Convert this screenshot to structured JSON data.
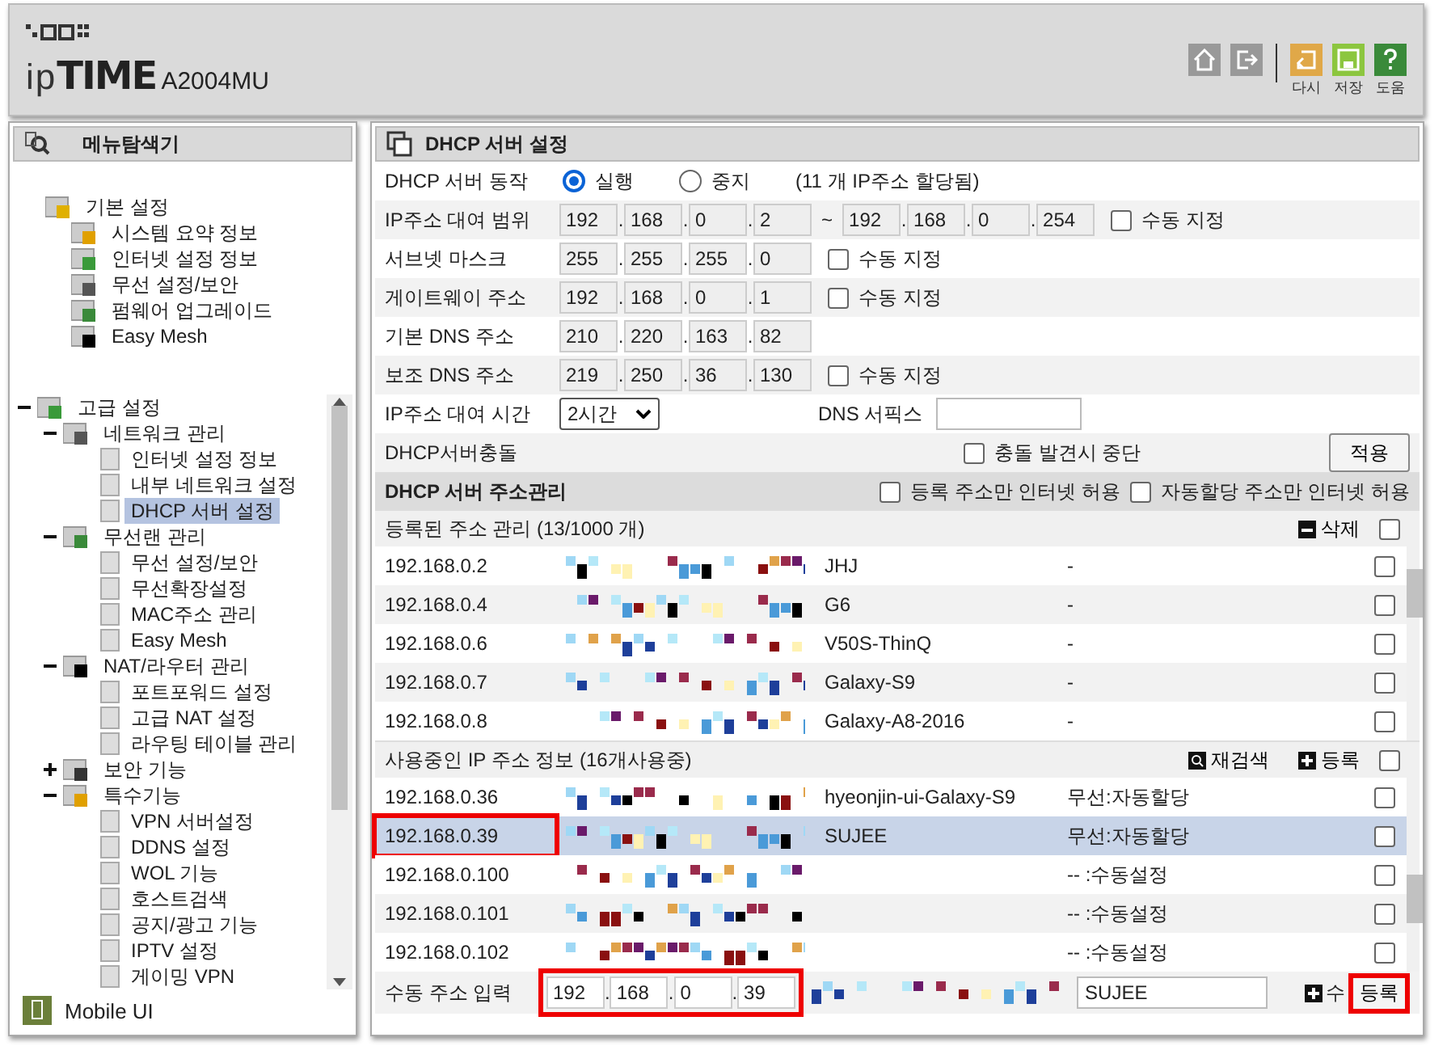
{
  "header": {
    "logo_prefix": "ip",
    "logo_main": "TIME",
    "model": "A2004MU",
    "buttons": [
      {
        "kind": "home"
      },
      {
        "kind": "logout"
      },
      {
        "kind": "refresh",
        "label": "다시"
      },
      {
        "kind": "save",
        "label": "저장"
      },
      {
        "kind": "help",
        "label": "도움"
      }
    ]
  },
  "sidebar": {
    "title": "메뉴탐색기",
    "basic": {
      "label": "기본 설정",
      "items": [
        {
          "label": "시스템 요약 정보",
          "selected": false
        },
        {
          "label": "인터넷 설정 정보",
          "selected": false
        },
        {
          "label": "무선 설정/보안",
          "selected": false
        },
        {
          "label": "펌웨어 업그레이드",
          "selected": false
        },
        {
          "label": "Easy Mesh",
          "selected": false
        }
      ]
    },
    "advanced": {
      "label": "고급 설정",
      "expanded": true,
      "children": [
        {
          "label": "네트워크 관리",
          "expanded": true,
          "children": [
            {
              "label": "인터넷 설정 정보",
              "selected": false
            },
            {
              "label": "내부 네트워크 설정",
              "selected": false
            },
            {
              "label": "DHCP 서버 설정",
              "selected": true
            }
          ]
        },
        {
          "label": "무선랜 관리",
          "expanded": true,
          "children": [
            {
              "label": "무선 설정/보안",
              "selected": false
            },
            {
              "label": "무선확장설정",
              "selected": false
            },
            {
              "label": "MAC주소 관리",
              "selected": false
            },
            {
              "label": "Easy Mesh",
              "selected": false
            }
          ]
        },
        {
          "label": "NAT/라우터 관리",
          "expanded": true,
          "children": [
            {
              "label": "포트포워드 설정",
              "selected": false
            },
            {
              "label": "고급 NAT 설정",
              "selected": false
            },
            {
              "label": "라우팅 테이블 관리",
              "selected": false
            }
          ]
        },
        {
          "label": "보안 기능",
          "expanded": false
        },
        {
          "label": "특수기능",
          "expanded": true,
          "children": [
            {
              "label": "VPN 서버설정",
              "selected": false
            },
            {
              "label": "DDNS 설정",
              "selected": false
            },
            {
              "label": "WOL 기능",
              "selected": false
            },
            {
              "label": "호스트검색",
              "selected": false
            },
            {
              "label": "공지/광고 기능",
              "selected": false
            },
            {
              "label": "IPTV 설정",
              "selected": false
            },
            {
              "label": "게이밍 VPN",
              "selected": false
            }
          ]
        }
      ]
    },
    "mobile": "Mobile UI"
  },
  "main": {
    "title": "DHCP 서버 설정",
    "separator": ".",
    "form": [
      {
        "kind": "radio",
        "label": "DHCP 서버 동작",
        "options": [
          {
            "label": "실행",
            "selected": true
          },
          {
            "label": "중지",
            "selected": false
          }
        ],
        "note": "(11 개 IP주소 할당됨)"
      },
      {
        "kind": "range",
        "label": "IP주소 대여 범위",
        "start": [
          "192",
          "168",
          "0",
          "2"
        ],
        "tilde": "~",
        "end": [
          "192",
          "168",
          "0",
          "254"
        ],
        "checkbox": {
          "label": "수동 지정",
          "checked": false
        }
      },
      {
        "kind": "ip",
        "label": "서브넷 마스크",
        "ip": [
          "255",
          "255",
          "255",
          "0"
        ],
        "checkbox": {
          "label": "수동 지정",
          "checked": false
        }
      },
      {
        "kind": "ip",
        "label": "게이트웨이 주소",
        "ip": [
          "192",
          "168",
          "0",
          "1"
        ],
        "checkbox": {
          "label": "수동 지정",
          "checked": false
        }
      },
      {
        "kind": "ip",
        "label": "기본 DNS 주소",
        "ip": [
          "210",
          "220",
          "163",
          "82"
        ]
      },
      {
        "kind": "ip",
        "label": "보조 DNS 주소",
        "ip": [
          "219",
          "250",
          "36",
          "130"
        ],
        "checkbox": {
          "label": "수동 지정",
          "checked": false
        }
      },
      {
        "kind": "select",
        "label": "IP주소 대여 시간",
        "value": "2시간",
        "suffix_label": "DNS 서픽스"
      },
      {
        "kind": "conflict",
        "label": "DHCP서버충돌",
        "checkbox": {
          "label": "충돌 발견시 중단",
          "checked": false
        },
        "button": "적용"
      }
    ],
    "management": {
      "title": "DHCP 서버 주소관리",
      "options": [
        {
          "label": "등록 주소만 인터넷 허용",
          "checked": false
        },
        {
          "label": "자동할당 주소만 인터넷 허용",
          "checked": false
        }
      ]
    },
    "registered": {
      "title": "등록된 주소 관리 (13/1000 개)",
      "delete": "삭제",
      "all_checked": false,
      "rows": [
        {
          "ip": "192.168.0.2",
          "name": "JHJ",
          "status": "-",
          "checked": false,
          "selected": false,
          "highlighted": false
        },
        {
          "ip": "192.168.0.4",
          "name": "G6",
          "status": "-",
          "checked": false,
          "selected": false,
          "highlighted": false
        },
        {
          "ip": "192.168.0.6",
          "name": "V50S-ThinQ",
          "status": "-",
          "checked": false,
          "selected": false,
          "highlighted": false
        },
        {
          "ip": "192.168.0.7",
          "name": "Galaxy-S9",
          "status": "-",
          "checked": false,
          "selected": false,
          "highlighted": false
        },
        {
          "ip": "192.168.0.8",
          "name": "Galaxy-A8-2016",
          "status": "-",
          "checked": false,
          "selected": false,
          "highlighted": false
        }
      ]
    },
    "in_use": {
      "title": "사용중인 IP 주소 정보 (16개사용중)",
      "rescan": "재검색",
      "register": "등록",
      "all_checked": false,
      "rows": [
        {
          "ip": "192.168.0.36",
          "name": "hyeonjin-ui-Galaxy-S9",
          "status": "무선:자동할당",
          "checked": false,
          "selected": false,
          "highlighted": false
        },
        {
          "ip": "192.168.0.39",
          "name": "SUJEE",
          "status": "무선:자동할당",
          "checked": false,
          "selected": true,
          "highlighted": true
        },
        {
          "ip": "192.168.0.100",
          "status": "-- :수동설정",
          "checked": false,
          "selected": false,
          "highlighted": false
        },
        {
          "ip": "192.168.0.101",
          "status": "-- :수동설정",
          "checked": false,
          "selected": false,
          "highlighted": false
        },
        {
          "ip": "192.168.0.102",
          "status": "-- :수동설정",
          "checked": false,
          "selected": false,
          "highlighted": false
        }
      ]
    },
    "manual": {
      "label": "수동 주소 입력",
      "ip": [
        "192",
        "168",
        "0",
        "39"
      ],
      "ip_highlighted": true,
      "name": "SUJEE",
      "add_label": "수",
      "button": "등록",
      "button_highlighted": true
    }
  }
}
